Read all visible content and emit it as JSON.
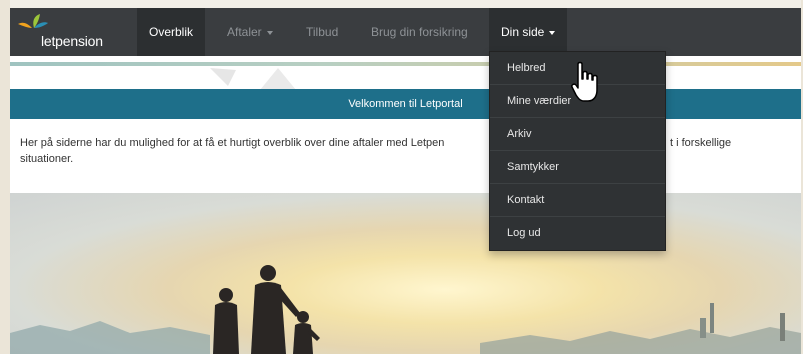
{
  "brand": {
    "name": "letpension",
    "colors": [
      "#9cc63a",
      "#f0a21e",
      "#2a8fb5"
    ]
  },
  "nav": {
    "items": [
      {
        "label": "Overblik",
        "state": "active"
      },
      {
        "label": "Aftaler",
        "has_caret": true
      },
      {
        "label": "Tilbud"
      },
      {
        "label": "Brug din forsikring"
      },
      {
        "label": "Din side",
        "has_caret": true,
        "state": "open"
      }
    ]
  },
  "dropdown": {
    "items": [
      "Helbred",
      "Mine værdier",
      "Arkiv",
      "Samtykker",
      "Kontakt",
      "Log ud"
    ]
  },
  "banner": {
    "title": "Velkommen til Letportal"
  },
  "intro": {
    "line1": "Her på siderne har du mulighed for at få et hurtigt overblik over dine aftaler med Letpen",
    "line1_tail": "t i forskellige",
    "line2": "situationer."
  },
  "colors": {
    "navbar": "#3a3d40",
    "banner": "#1e6f8a",
    "dropdown": "#2f3234"
  }
}
